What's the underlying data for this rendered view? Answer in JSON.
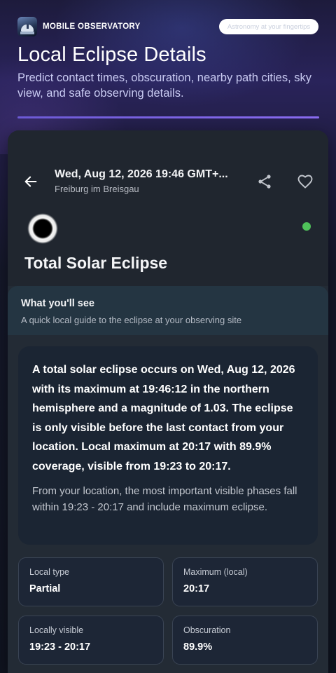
{
  "app": {
    "brand": "MOBILE OBSERVATORY",
    "tagline": "Astronomy at your fingertips",
    "page_title": "Local Eclipse Details",
    "page_subtitle": "Predict contact times, obscuration, nearby path cities, sky view, and safe observing details."
  },
  "header": {
    "title": "Wed, Aug 12, 2026 19:46 GMT+...",
    "subtitle": "Freiburg im Breisgau",
    "icons": [
      "back-arrow-icon",
      "share-icon",
      "heart-icon"
    ]
  },
  "event": {
    "title": "Total Solar Eclipse",
    "status_color": "#4fc25a"
  },
  "see_section": {
    "title": "What you'll see",
    "subtitle": "A quick local guide to the eclipse at your observing site"
  },
  "summary": {
    "main": "A total solar eclipse occurs on Wed, Aug 12, 2026 with its maximum at 19:46:12 in the northern hemisphere and a magnitude of 1.03. The eclipse is only visible before the last contact from your location. Local maximum at 20:17 with 89.9% coverage, visible from 19:23 to 20:17.",
    "note": "From your location, the most important visible phases fall within 19:23 - 20:17 and include maximum eclipse."
  },
  "stats": [
    {
      "label": "Local type",
      "value": "Partial"
    },
    {
      "label": "Maximum (local)",
      "value": "20:17"
    },
    {
      "label": "Locally visible",
      "value": "19:23 - 20:17"
    },
    {
      "label": "Obscuration",
      "value": "89.9%"
    }
  ],
  "colors": {
    "accent": "#7b63e6",
    "card": "#232b35",
    "section": "#243542"
  }
}
